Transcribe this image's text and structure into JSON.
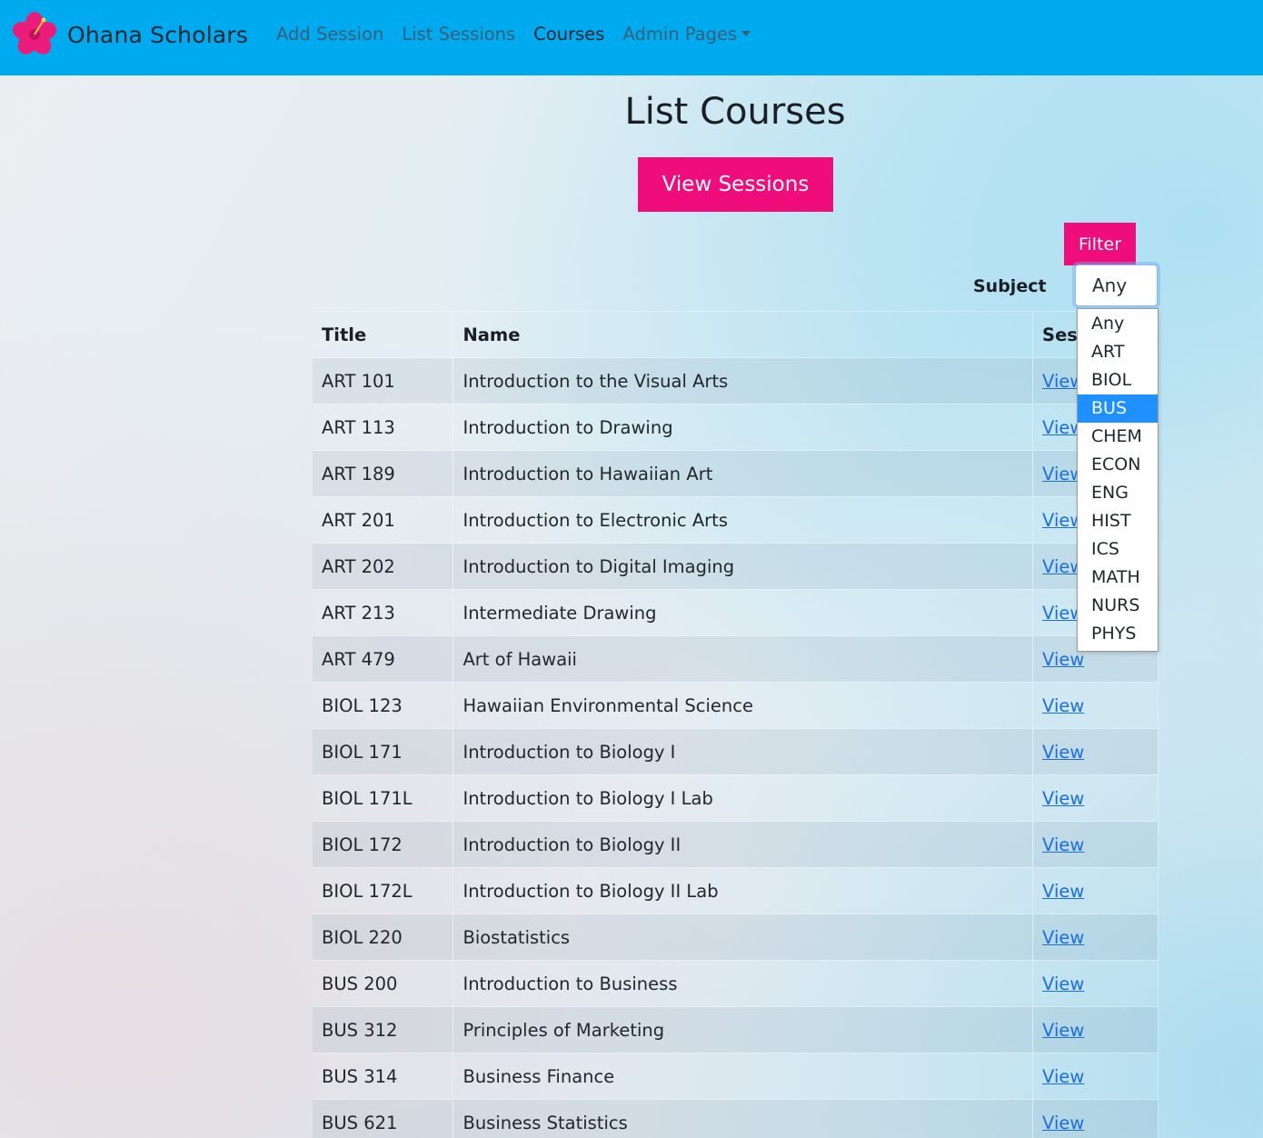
{
  "navbar": {
    "brand": "Ohana Scholars",
    "links": [
      {
        "label": "Add Session",
        "active": false
      },
      {
        "label": "List Sessions",
        "active": false
      },
      {
        "label": "Courses",
        "active": true
      },
      {
        "label": "Admin Pages",
        "active": false,
        "dropdown": true
      }
    ],
    "logo_icon": "hibiscus-flower-icon",
    "background_color": "#00aaef"
  },
  "page": {
    "title": "List Courses",
    "view_sessions_button": "View Sessions"
  },
  "filter": {
    "button_label": "Filter",
    "subject_label": "Subject",
    "selected": "Any",
    "options": [
      "Any",
      "ART",
      "BIOL",
      "BUS",
      "CHEM",
      "ECON",
      "ENG",
      "HIST",
      "ICS",
      "MATH",
      "NURS",
      "PHYS"
    ],
    "highlighted_option": "BUS"
  },
  "table": {
    "headers": [
      "Title",
      "Name",
      "Sessions"
    ],
    "rows": [
      {
        "title": "ART 101",
        "name": "Introduction to the Visual Arts",
        "link": "View"
      },
      {
        "title": "ART 113",
        "name": "Introduction to Drawing",
        "link": "View"
      },
      {
        "title": "ART 189",
        "name": "Introduction to Hawaiian Art",
        "link": "View"
      },
      {
        "title": "ART 201",
        "name": "Introduction to Electronic Arts",
        "link": "View"
      },
      {
        "title": "ART 202",
        "name": "Introduction to Digital Imaging",
        "link": "View"
      },
      {
        "title": "ART 213",
        "name": "Intermediate Drawing",
        "link": "View"
      },
      {
        "title": "ART 479",
        "name": "Art of Hawaii",
        "link": "View"
      },
      {
        "title": "BIOL 123",
        "name": "Hawaiian Environmental Science",
        "link": "View"
      },
      {
        "title": "BIOL 171",
        "name": "Introduction to Biology I",
        "link": "View"
      },
      {
        "title": "BIOL 171L",
        "name": "Introduction to Biology I Lab",
        "link": "View"
      },
      {
        "title": "BIOL 172",
        "name": "Introduction to Biology II",
        "link": "View"
      },
      {
        "title": "BIOL 172L",
        "name": "Introduction to Biology II Lab",
        "link": "View"
      },
      {
        "title": "BIOL 220",
        "name": "Biostatistics",
        "link": "View"
      },
      {
        "title": "BUS 200",
        "name": "Introduction to Business",
        "link": "View"
      },
      {
        "title": "BUS 312",
        "name": "Principles of Marketing",
        "link": "View"
      },
      {
        "title": "BUS 314",
        "name": "Business Finance",
        "link": "View"
      },
      {
        "title": "BUS 621",
        "name": "Business Statistics",
        "link": "View"
      }
    ]
  },
  "colors": {
    "accent_pink": "#ef0d7b",
    "link_blue": "#1a6fe0",
    "highlight_blue": "#1e90ff"
  }
}
